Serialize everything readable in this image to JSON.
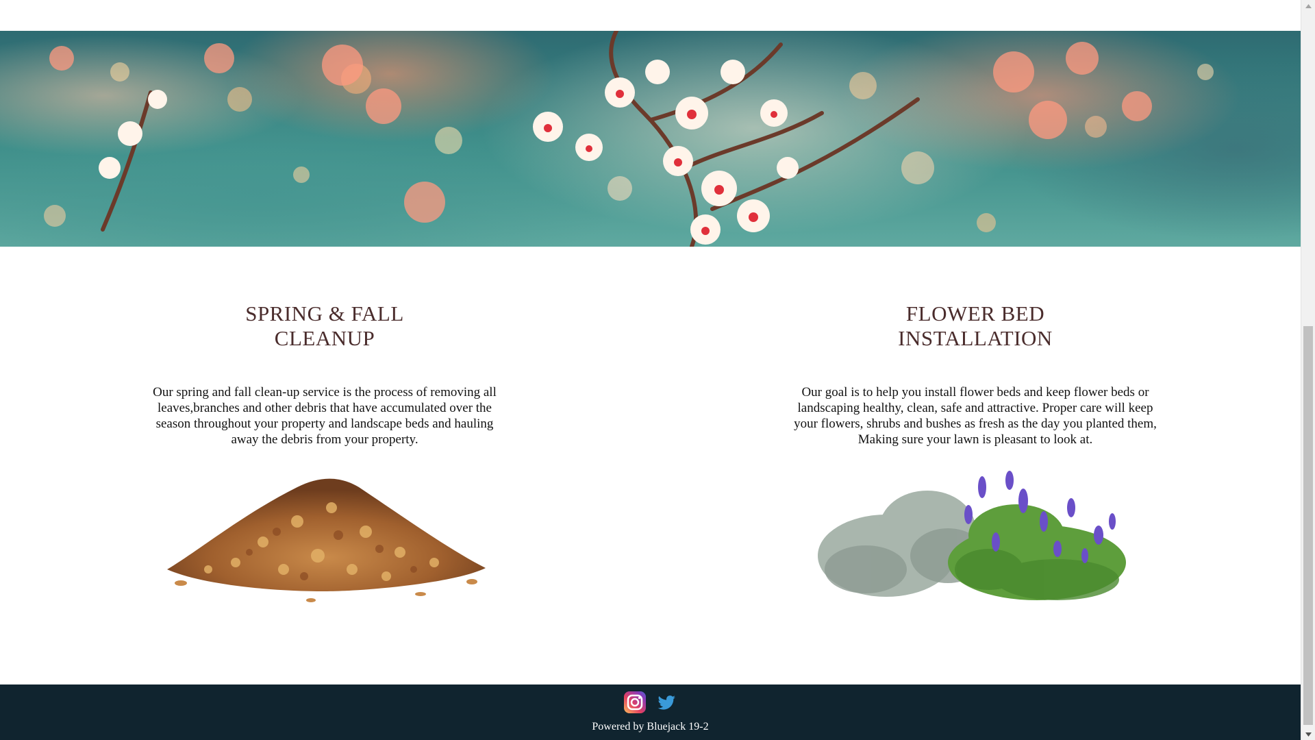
{
  "banner": {
    "alt": "blossom-branch-banner"
  },
  "services": [
    {
      "title": "SPRING & FALL CLEANUP",
      "title_line1": "SPRING & FALL",
      "title_line2": "CLEANUP",
      "description": "Our spring and fall clean-up service is the process of removing all leaves,branches and other debris that have accumulated over the season throughout your property and landscape beds and hauling away the debris from your property.",
      "image": "leaf-pile-image"
    },
    {
      "title": "FLOWER BED INSTALLATION",
      "title_line1": "FLOWER BED",
      "title_line2": "INSTALLATION",
      "description": "Our goal is to help you install flower beds and keep flower beds or landscaping healthy, clean, safe and attractive. Proper care will keep your flowers, shrubs and bushes as fresh as the day you planted them, Making sure your lawn is pleasant to look at.",
      "image": "flower-bush-image"
    }
  ],
  "footer": {
    "icons": [
      "instagram-icon",
      "twitter-icon"
    ],
    "powered_by": "Powered by Bluejack 19-2",
    "background": "#10242f"
  },
  "colors": {
    "heading": "#4a2c2c",
    "body_text": "#111111",
    "footer_bg": "#10242f"
  }
}
